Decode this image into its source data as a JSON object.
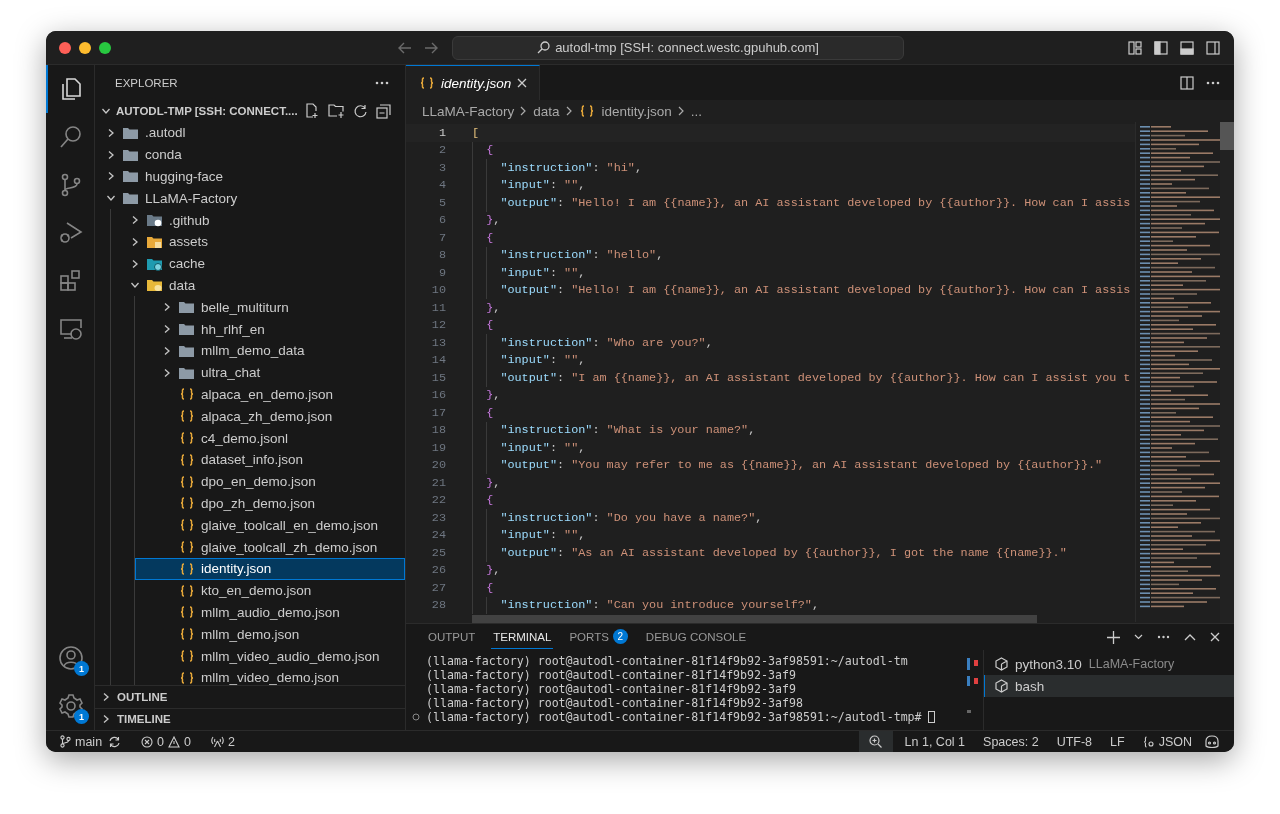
{
  "window": {
    "title": "autodl-tmp [SSH: connect.westc.gpuhub.com]"
  },
  "activity_bar": {
    "items": [
      {
        "kind": "files",
        "selected": true
      },
      {
        "kind": "search",
        "selected": false
      },
      {
        "kind": "source-control",
        "selected": false
      },
      {
        "kind": "run-debug",
        "selected": false
      },
      {
        "kind": "extensions",
        "selected": false
      },
      {
        "kind": "remote",
        "selected": false
      }
    ],
    "bottom": [
      {
        "kind": "account",
        "badge": "1"
      },
      {
        "kind": "settings",
        "badge": "1"
      }
    ]
  },
  "explorer": {
    "title": "EXPLORER",
    "root": {
      "label": "AUTODL-TMP [SSH: CONNECT....",
      "expanded": true,
      "children": [
        {
          "label": ".autodl",
          "kind": "folder",
          "expanded": false,
          "selected": false
        },
        {
          "label": "conda",
          "kind": "folder",
          "expanded": false,
          "selected": false
        },
        {
          "label": "hugging-face",
          "kind": "folder",
          "expanded": false,
          "selected": false
        },
        {
          "label": "LLaMA-Factory",
          "kind": "folder",
          "expanded": true,
          "selected": false,
          "children": [
            {
              "label": ".github",
              "kind": "github-folder",
              "expanded": false,
              "selected": false
            },
            {
              "label": "assets",
              "kind": "assets-folder",
              "expanded": false,
              "selected": false
            },
            {
              "label": "cache",
              "kind": "cache-folder",
              "expanded": false,
              "selected": false
            },
            {
              "label": "data",
              "kind": "data-folder",
              "expanded": true,
              "selected": false,
              "children": [
                {
                  "label": "belle_multiturn",
                  "kind": "folder",
                  "expanded": false,
                  "selected": false
                },
                {
                  "label": "hh_rlhf_en",
                  "kind": "folder",
                  "expanded": false,
                  "selected": false
                },
                {
                  "label": "mllm_demo_data",
                  "kind": "folder",
                  "expanded": false,
                  "selected": false
                },
                {
                  "label": "ultra_chat",
                  "kind": "folder",
                  "expanded": false,
                  "selected": false
                },
                {
                  "label": "alpaca_en_demo.json",
                  "kind": "json-file",
                  "selected": false
                },
                {
                  "label": "alpaca_zh_demo.json",
                  "kind": "json-file",
                  "selected": false
                },
                {
                  "label": "c4_demo.jsonl",
                  "kind": "json-file",
                  "selected": false
                },
                {
                  "label": "dataset_info.json",
                  "kind": "json-file",
                  "selected": false
                },
                {
                  "label": "dpo_en_demo.json",
                  "kind": "json-file",
                  "selected": false
                },
                {
                  "label": "dpo_zh_demo.json",
                  "kind": "json-file",
                  "selected": false
                },
                {
                  "label": "glaive_toolcall_en_demo.json",
                  "kind": "json-file",
                  "selected": false
                },
                {
                  "label": "glaive_toolcall_zh_demo.json",
                  "kind": "json-file",
                  "selected": false
                },
                {
                  "label": "identity.json",
                  "kind": "json-file",
                  "selected": true
                },
                {
                  "label": "kto_en_demo.json",
                  "kind": "json-file",
                  "selected": false
                },
                {
                  "label": "mllm_audio_demo.json",
                  "kind": "json-file",
                  "selected": false
                },
                {
                  "label": "mllm_demo.json",
                  "kind": "json-file",
                  "selected": false
                },
                {
                  "label": "mllm_video_audio_demo.json",
                  "kind": "json-file",
                  "selected": false
                },
                {
                  "label": "mllm_video_demo.json",
                  "kind": "json-file",
                  "selected": false
                }
              ]
            }
          ]
        }
      ]
    },
    "sections": [
      {
        "label": "OUTLINE",
        "expanded": false
      },
      {
        "label": "TIMELINE",
        "expanded": false
      }
    ]
  },
  "editor": {
    "tabs": [
      {
        "label": "identity.json",
        "selected": true,
        "preview": true
      }
    ],
    "breadcrumbs": [
      "LLaMA-Factory",
      "data",
      "identity.json",
      "..."
    ],
    "lines": [
      {
        "number": "1",
        "current": true,
        "tokens": [
          {
            "kind": "open-bracket",
            "text": "["
          }
        ]
      },
      {
        "number": "2",
        "current": false,
        "tokens": [
          {
            "kind": "open-brace",
            "text": "{"
          }
        ]
      },
      {
        "number": "3",
        "current": false,
        "tokens": [
          {
            "kind": "key",
            "text": "\"instruction\""
          },
          {
            "kind": "punct",
            "text": ": "
          },
          {
            "kind": "string",
            "text": "\"hi\""
          },
          {
            "kind": "punct",
            "text": ","
          }
        ]
      },
      {
        "number": "4",
        "current": false,
        "tokens": [
          {
            "kind": "key",
            "text": "\"input\""
          },
          {
            "kind": "punct",
            "text": ": "
          },
          {
            "kind": "string",
            "text": "\"\""
          },
          {
            "kind": "punct",
            "text": ","
          }
        ]
      },
      {
        "number": "5",
        "current": false,
        "tokens": [
          {
            "kind": "key",
            "text": "\"output\""
          },
          {
            "kind": "punct",
            "text": ": "
          },
          {
            "kind": "string",
            "text": "\"Hello! I am {{name}}, an AI assistant developed by {{author}}. How can I assis"
          }
        ]
      },
      {
        "number": "6",
        "current": false,
        "tokens": [
          {
            "kind": "close-brace",
            "text": "}"
          },
          {
            "kind": "punct",
            "text": ","
          }
        ]
      },
      {
        "number": "7",
        "current": false,
        "tokens": [
          {
            "kind": "open-brace",
            "text": "{"
          }
        ]
      },
      {
        "number": "8",
        "current": false,
        "tokens": [
          {
            "kind": "key",
            "text": "\"instruction\""
          },
          {
            "kind": "punct",
            "text": ": "
          },
          {
            "kind": "string",
            "text": "\"hello\""
          },
          {
            "kind": "punct",
            "text": ","
          }
        ]
      },
      {
        "number": "9",
        "current": false,
        "tokens": [
          {
            "kind": "key",
            "text": "\"input\""
          },
          {
            "kind": "punct",
            "text": ": "
          },
          {
            "kind": "string",
            "text": "\"\""
          },
          {
            "kind": "punct",
            "text": ","
          }
        ]
      },
      {
        "number": "10",
        "current": false,
        "tokens": [
          {
            "kind": "key",
            "text": "\"output\""
          },
          {
            "kind": "punct",
            "text": ": "
          },
          {
            "kind": "string",
            "text": "\"Hello! I am {{name}}, an AI assistant developed by {{author}}. How can I assis"
          }
        ]
      },
      {
        "number": "11",
        "current": false,
        "tokens": [
          {
            "kind": "close-brace",
            "text": "}"
          },
          {
            "kind": "punct",
            "text": ","
          }
        ]
      },
      {
        "number": "12",
        "current": false,
        "tokens": [
          {
            "kind": "open-brace",
            "text": "{"
          }
        ]
      },
      {
        "number": "13",
        "current": false,
        "tokens": [
          {
            "kind": "key",
            "text": "\"instruction\""
          },
          {
            "kind": "punct",
            "text": ": "
          },
          {
            "kind": "string",
            "text": "\"Who are you?\""
          },
          {
            "kind": "punct",
            "text": ","
          }
        ]
      },
      {
        "number": "14",
        "current": false,
        "tokens": [
          {
            "kind": "key",
            "text": "\"input\""
          },
          {
            "kind": "punct",
            "text": ": "
          },
          {
            "kind": "string",
            "text": "\"\""
          },
          {
            "kind": "punct",
            "text": ","
          }
        ]
      },
      {
        "number": "15",
        "current": false,
        "tokens": [
          {
            "kind": "key",
            "text": "\"output\""
          },
          {
            "kind": "punct",
            "text": ": "
          },
          {
            "kind": "string",
            "text": "\"I am {{name}}, an AI assistant developed by {{author}}. How can I assist you t"
          }
        ]
      },
      {
        "number": "16",
        "current": false,
        "tokens": [
          {
            "kind": "close-brace",
            "text": "}"
          },
          {
            "kind": "punct",
            "text": ","
          }
        ]
      },
      {
        "number": "17",
        "current": false,
        "tokens": [
          {
            "kind": "open-brace",
            "text": "{"
          }
        ]
      },
      {
        "number": "18",
        "current": false,
        "tokens": [
          {
            "kind": "key",
            "text": "\"instruction\""
          },
          {
            "kind": "punct",
            "text": ": "
          },
          {
            "kind": "string",
            "text": "\"What is your name?\""
          },
          {
            "kind": "punct",
            "text": ","
          }
        ]
      },
      {
        "number": "19",
        "current": false,
        "tokens": [
          {
            "kind": "key",
            "text": "\"input\""
          },
          {
            "kind": "punct",
            "text": ": "
          },
          {
            "kind": "string",
            "text": "\"\""
          },
          {
            "kind": "punct",
            "text": ","
          }
        ]
      },
      {
        "number": "20",
        "current": false,
        "tokens": [
          {
            "kind": "key",
            "text": "\"output\""
          },
          {
            "kind": "punct",
            "text": ": "
          },
          {
            "kind": "string",
            "text": "\"You may refer to me as {{name}}, an AI assistant developed by {{author}}.\""
          }
        ]
      },
      {
        "number": "21",
        "current": false,
        "tokens": [
          {
            "kind": "close-brace",
            "text": "}"
          },
          {
            "kind": "punct",
            "text": ","
          }
        ]
      },
      {
        "number": "22",
        "current": false,
        "tokens": [
          {
            "kind": "open-brace",
            "text": "{"
          }
        ]
      },
      {
        "number": "23",
        "current": false,
        "tokens": [
          {
            "kind": "key",
            "text": "\"instruction\""
          },
          {
            "kind": "punct",
            "text": ": "
          },
          {
            "kind": "string",
            "text": "\"Do you have a name?\""
          },
          {
            "kind": "punct",
            "text": ","
          }
        ]
      },
      {
        "number": "24",
        "current": false,
        "tokens": [
          {
            "kind": "key",
            "text": "\"input\""
          },
          {
            "kind": "punct",
            "text": ": "
          },
          {
            "kind": "string",
            "text": "\"\""
          },
          {
            "kind": "punct",
            "text": ","
          }
        ]
      },
      {
        "number": "25",
        "current": false,
        "tokens": [
          {
            "kind": "key",
            "text": "\"output\""
          },
          {
            "kind": "punct",
            "text": ": "
          },
          {
            "kind": "string",
            "text": "\"As an AI assistant developed by {{author}}, I got the name {{name}}.\""
          }
        ]
      },
      {
        "number": "26",
        "current": false,
        "tokens": [
          {
            "kind": "close-brace",
            "text": "}"
          },
          {
            "kind": "punct",
            "text": ","
          }
        ]
      },
      {
        "number": "27",
        "current": false,
        "tokens": [
          {
            "kind": "open-brace",
            "text": "{"
          }
        ]
      },
      {
        "number": "28",
        "current": false,
        "tokens": [
          {
            "kind": "key",
            "text": "\"instruction\""
          },
          {
            "kind": "punct",
            "text": ": "
          },
          {
            "kind": "string",
            "text": "\"Can you introduce yourself?\""
          },
          {
            "kind": "punct",
            "text": ","
          }
        ]
      }
    ]
  },
  "panel": {
    "tabs": [
      {
        "label": "OUTPUT",
        "selected": false
      },
      {
        "label": "TERMINAL",
        "selected": true
      },
      {
        "label": "PORTS",
        "selected": false,
        "badge": "2"
      },
      {
        "label": "DEBUG CONSOLE",
        "selected": false
      }
    ],
    "terminal_lines": [
      {
        "text": "(llama-factory) root@autodl-container-81f14f9b92-3af98591:~/autodl-tm",
        "marker": false,
        "cursor": false
      },
      {
        "text": "(llama-factory) root@autodl-container-81f14f9b92-3af9",
        "marker": false,
        "cursor": false
      },
      {
        "text": "(llama-factory) root@autodl-container-81f14f9b92-3af9",
        "marker": false,
        "cursor": false
      },
      {
        "text": "(llama-factory) root@autodl-container-81f14f9b92-3af98",
        "marker": false,
        "cursor": false
      },
      {
        "text": "(llama-factory) root@autodl-container-81f14f9b92-3af98591:~/autodl-tmp#",
        "marker": true,
        "cursor": true
      }
    ],
    "terminals": [
      {
        "name": "python3.10",
        "detail": "LLaMA-Factory",
        "selected": false
      },
      {
        "name": "bash",
        "selected": true
      }
    ]
  },
  "status_bar": {
    "branch": "main",
    "errors": "0",
    "warnings": "0",
    "ports": "2",
    "position": "Ln 1, Col 1",
    "indent": "Spaces: 2",
    "encoding": "UTF-8",
    "eol": "LF",
    "language": "JSON"
  }
}
